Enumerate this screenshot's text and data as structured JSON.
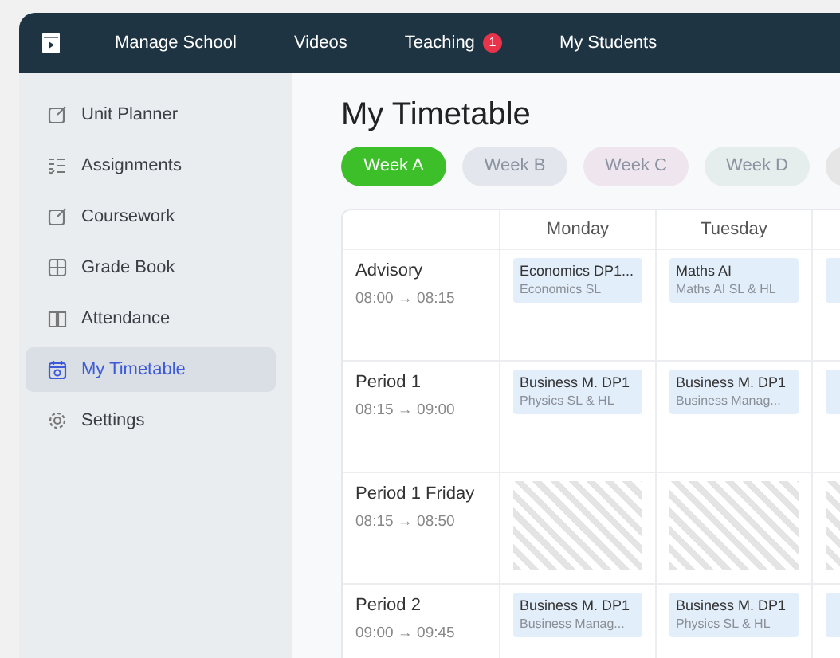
{
  "navbar": {
    "items": [
      {
        "label": "Manage School"
      },
      {
        "label": "Videos"
      },
      {
        "label": "Teaching",
        "badge": "1"
      },
      {
        "label": "My Students"
      }
    ]
  },
  "sidebar": {
    "items": [
      {
        "label": "Unit Planner",
        "kind": "edit",
        "selected": false
      },
      {
        "label": "Assignments",
        "kind": "list",
        "selected": false
      },
      {
        "label": "Coursework",
        "kind": "edit",
        "selected": false
      },
      {
        "label": "Grade Book",
        "kind": "grid",
        "selected": false
      },
      {
        "label": "Attendance",
        "kind": "book",
        "selected": false
      },
      {
        "label": "My Timetable",
        "kind": "calendar",
        "selected": true
      },
      {
        "label": "Settings",
        "kind": "gear",
        "selected": false
      }
    ]
  },
  "title": "My Timetable",
  "weeks": [
    {
      "label": "Week A",
      "selected": true,
      "color": "#3dbf2a"
    },
    {
      "label": "Week B",
      "selected": false,
      "color": "#e3e7ed"
    },
    {
      "label": "Week C",
      "selected": false,
      "color": "#efe5ef"
    },
    {
      "label": "Week D",
      "selected": false,
      "color": "#e5eded"
    },
    {
      "color": "#e6e6e6"
    }
  ],
  "timetable": {
    "columns": [
      "Monday",
      "Tuesday"
    ],
    "rows": [
      {
        "period": "Advisory",
        "time": "08:00 → 08:15",
        "slots": [
          {
            "kind": "class",
            "title": "Economics DP1...",
            "subtitle": "Economics SL"
          },
          {
            "kind": "class",
            "title": "Maths AI",
            "subtitle": "Maths AI SL & HL"
          },
          {
            "kind": "class"
          }
        ]
      },
      {
        "period": "Period 1",
        "time": "08:15 → 09:00",
        "slots": [
          {
            "kind": "class",
            "title": "Business M. DP1",
            "subtitle": "Physics SL & HL"
          },
          {
            "kind": "class",
            "title": "Business M. DP1",
            "subtitle": "Business Manag..."
          },
          {
            "kind": "class"
          }
        ]
      },
      {
        "period": "Period 1 Friday",
        "time": "08:15 → 08:50",
        "slots": [
          {
            "kind": "free"
          },
          {
            "kind": "free"
          },
          {
            "kind": "free"
          }
        ]
      },
      {
        "period": "Period 2",
        "time": "09:00 → 09:45",
        "slots": [
          {
            "kind": "class",
            "title": "Business M. DP1",
            "subtitle": "Business Manag..."
          },
          {
            "kind": "class",
            "title": "Business M. DP1",
            "subtitle": "Physics SL & HL"
          },
          {
            "kind": "class"
          }
        ]
      }
    ]
  }
}
